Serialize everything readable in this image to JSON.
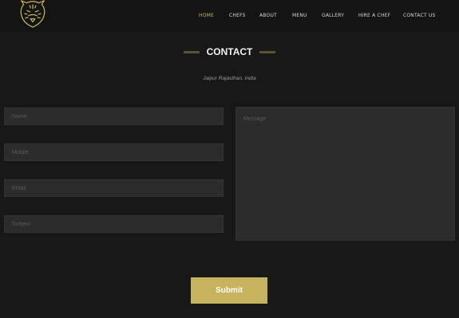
{
  "header": {
    "nav": [
      {
        "label": "HOME",
        "active": true
      },
      {
        "label": "CHEFS",
        "active": false
      },
      {
        "label": "ABOUT",
        "active": false
      },
      {
        "label": "MENU",
        "active": false
      },
      {
        "label": "GALLERY",
        "active": false
      },
      {
        "label": "HIRE A CHEF",
        "active": false
      },
      {
        "label": "CONTACT US",
        "active": false
      }
    ]
  },
  "contact": {
    "title": "CONTACT",
    "location": "Jaipur Rajasthan, India"
  },
  "form": {
    "name_placeholder": "Name",
    "mobile_placeholder": "Mobile",
    "email_placeholder": "Email",
    "subject_placeholder": "Subject",
    "message_placeholder": "Message",
    "submit_label": "Submit"
  },
  "colors": {
    "accent": "#c6b35e",
    "background": "#181818",
    "field": "#2c2c2c"
  }
}
